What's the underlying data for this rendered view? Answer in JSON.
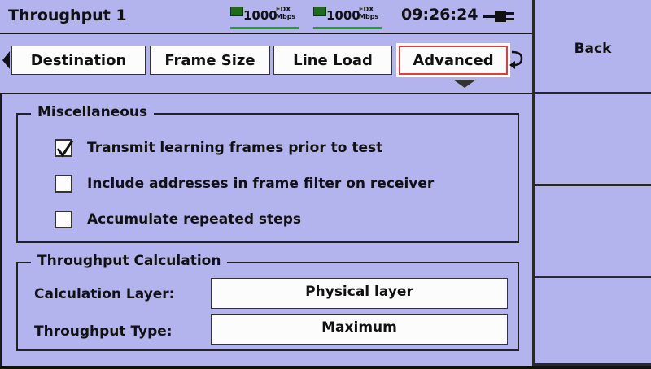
{
  "header": {
    "title": "Throughput 1",
    "port1": {
      "speed": "1000",
      "duplex_top": "FDX",
      "duplex_bottom": "Mbps"
    },
    "port2": {
      "speed": "1000",
      "duplex_top": "FDX",
      "duplex_bottom": "Mbps"
    },
    "time": "09:26:24"
  },
  "tabs": [
    {
      "label": "Destination",
      "active": false
    },
    {
      "label": "Frame Size",
      "active": false
    },
    {
      "label": "Line Load",
      "active": false
    },
    {
      "label": "Advanced",
      "active": true
    }
  ],
  "misc": {
    "title": "Miscellaneous",
    "options": [
      {
        "label": "Transmit learning frames prior to test",
        "checked": true
      },
      {
        "label": "Include addresses in frame filter on receiver",
        "checked": false
      },
      {
        "label": "Accumulate repeated steps",
        "checked": false
      }
    ]
  },
  "calc": {
    "title": "Throughput Calculation",
    "layer_label": "Calculation Layer:",
    "layer_value": "Physical layer",
    "type_label": "Throughput Type:",
    "type_value": "Maximum"
  },
  "fkeys": {
    "back_label": "Back"
  },
  "colors": {
    "background": "#b3b4ee",
    "field": "#fcfcfc",
    "active_tab_border": "#d94040",
    "link_green": "#1ea51e"
  }
}
